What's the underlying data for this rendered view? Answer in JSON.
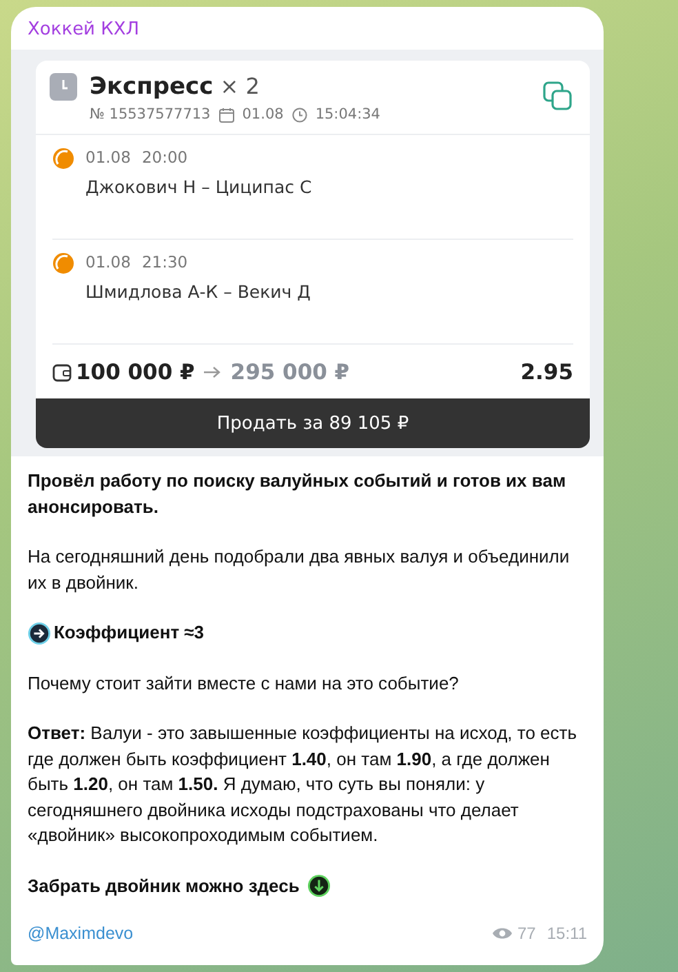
{
  "channel": {
    "name": "Хоккей КХЛ"
  },
  "bet_slip": {
    "title": "Экспресс",
    "multiplier": "× 2",
    "number": "№ 15537577713",
    "date": "01.08",
    "time": "15:04:34",
    "events": [
      {
        "date": "01.08",
        "time": "20:00",
        "match": "Джокович Н – Циципас С"
      },
      {
        "date": "01.08",
        "time": "21:30",
        "match": "Шмидлова А-К – Векич Д"
      }
    ],
    "stake": "100 000 ₽",
    "payout": "295 000 ₽",
    "odds": "2.95",
    "sell_button": "Продать за 89 105 ₽"
  },
  "post": {
    "paragraphs": [
      {
        "kind": "text",
        "bold": true,
        "text": "Провёл работу по поиску валуйных событий и готов их вам анонсировать."
      },
      {
        "kind": "text",
        "bold": false,
        "text": "На сегодняшний день подобрали два явных валуя и объединили их в двойник."
      },
      {
        "kind": "lead-icon",
        "bold": true,
        "text": "Коэффициент ≈3"
      },
      {
        "kind": "text",
        "bold": false,
        "text": "Почему стоит зайти вместе с нами на это событие?"
      },
      {
        "kind": "text",
        "bold": false,
        "text": "**Ответ:** Валуи - это завышенные коэффициенты на исход, то есть где должен быть коэффициент **1.40**, он там **1.90**, а где должен быть **1.20**, он там **1.50.** Я думаю, что суть вы поняли: у сегодняшнего двойника исходы подстрахованы что делает «двойник» высокопроходимым событием."
      },
      {
        "kind": "trail-icon",
        "bold": true,
        "text": "Забрать двойник можно здесь"
      }
    ],
    "link": "@Maximdevo",
    "views": "77",
    "time": "15:11"
  }
}
